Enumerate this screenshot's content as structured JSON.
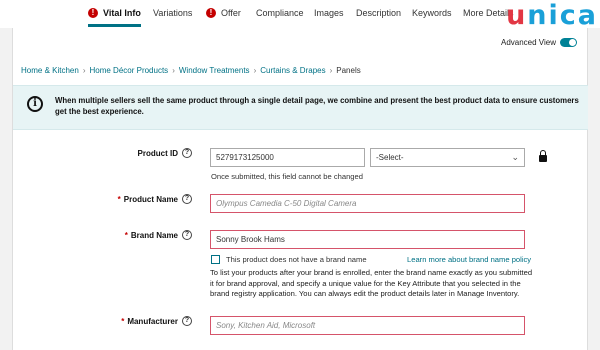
{
  "tabs": [
    {
      "label": "Vital Info",
      "warn": true,
      "active": true
    },
    {
      "label": "Variations",
      "warn": false,
      "active": false
    },
    {
      "label": "Offer",
      "warn": true,
      "active": false
    },
    {
      "label": "Compliance",
      "warn": false,
      "active": false
    },
    {
      "label": "Images",
      "warn": false,
      "active": false
    },
    {
      "label": "Description",
      "warn": false,
      "active": false
    },
    {
      "label": "Keywords",
      "warn": false,
      "active": false
    },
    {
      "label": "More Details",
      "warn": false,
      "active": false
    }
  ],
  "logo": {
    "first": "u",
    "rest": "nica"
  },
  "advanced_view": {
    "label": "Advanced View",
    "on": true
  },
  "breadcrumb": [
    "Home & Kitchen",
    "Home Décor Products",
    "Window Treatments",
    "Curtains & Drapes",
    "Panels"
  ],
  "info": {
    "icon": "i",
    "text": "When multiple sellers sell the same product through a single detail page, we combine and present the best product data to ensure customers get the best experience."
  },
  "help_glyph": "?",
  "required_mark": "*",
  "product_id": {
    "label": "Product ID",
    "value": "5279173125000",
    "type_select": "-Select-",
    "note": "Once submitted, this field cannot be changed"
  },
  "product_name": {
    "label": "Product Name",
    "placeholder": "Olympus Camedia C-50 Digital Camera"
  },
  "brand_name": {
    "label": "Brand Name",
    "value": "Sonny Brook Hams",
    "no_brand_label": "This product does not have a brand name",
    "policy_link": "Learn more about brand name policy",
    "instructions": "To list your products after your brand is enrolled, enter the brand name exactly as you submitted it for brand approval, and specify a unique value for the Key Attribute that you selected in the brand registry application. You can always edit the product details later in Manage Inventory."
  },
  "manufacturer": {
    "label": "Manufacturer",
    "placeholder": "Sony, Kitchen Aid, Microsoft"
  }
}
